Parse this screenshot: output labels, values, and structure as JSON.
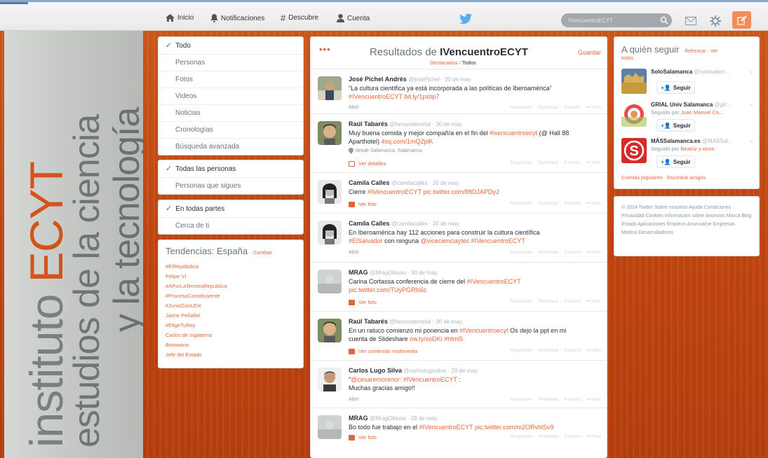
{
  "background": {
    "brand_prefix": "instituto ",
    "brand_accent": "ECYT",
    "brand_line2": "estudios de la ciencia",
    "brand_line3": "y la tecnología",
    "accent_color": "#c94a14"
  },
  "topnav": {
    "home": "Inicio",
    "notifications": "Notificaciones",
    "discover": "Descubre",
    "account": "Cuenta",
    "search_value": "IVencuentroECYT",
    "icons": [
      "home-icon",
      "bell-icon",
      "hashtag-icon",
      "person-icon",
      "twitter-bird-icon",
      "search-icon",
      "mail-icon",
      "gear-icon",
      "compose-icon"
    ]
  },
  "filters": {
    "type": [
      {
        "label": "Todo",
        "active": true
      },
      {
        "label": "Personas",
        "active": false
      },
      {
        "label": "Fotos",
        "active": false
      },
      {
        "label": "Videos",
        "active": false
      },
      {
        "label": "Noticias",
        "active": false
      },
      {
        "label": "Cronologías",
        "active": false
      },
      {
        "label": "Búsqueda avanzada",
        "active": false
      }
    ],
    "people": [
      {
        "label": "Todas las personas",
        "active": true
      },
      {
        "label": "Personas que sigues",
        "active": false
      }
    ],
    "place": [
      {
        "label": "En todas partes",
        "active": true
      },
      {
        "label": "Cerca de ti",
        "active": false
      }
    ]
  },
  "trends": {
    "title": "Tendencias: España",
    "change": "· Cambiar",
    "items": [
      "#ElReyAbdica",
      "Felipe VI",
      "#APorLaTerceraRepublica",
      "#ProcesoConstituyente",
      "#JunioConUDe",
      "Jaime Peñafiel",
      "#EligeTuRey",
      "Carlos de Inglaterra",
      "Botswana",
      "Jefe del Estado"
    ]
  },
  "results": {
    "title_prefix": "Resultados de ",
    "query": "IVencuentroECYT",
    "save": "Guardar",
    "dots": "•••",
    "subnav_top": "Destacados",
    "subnav_sep": " / ",
    "subnav_all": "Todos",
    "actions": {
      "reply": "Responder",
      "retweet": "Retwittear",
      "fav": "Favorito",
      "more": "••• Más"
    },
    "tweets": [
      {
        "name": "José Pichel Andrés",
        "handle": "@josePichel",
        "date": "30 de may.",
        "text": "“La cultura científica ya está incorporada a las políticas de Iberoamérica”",
        "text2": "#IVencuentroECYT bit.ly/1pstip7",
        "link": "Abrir"
      },
      {
        "name": "Raúl Tabarés",
        "handle": "@farsondemetal",
        "date": "30 de may.",
        "text": "Muy buena comida y mejor compañía en el fin del ",
        "hl": "#ivencuentroecyt",
        "text2": " (@ Hall 88 Aparthotel) ",
        "hl2": "4sq.com/1mQ2plK",
        "location": "desde Salamanca, Salamanca",
        "link": "Ver detalles"
      },
      {
        "name": "Camila Calles",
        "handle": "@camilacalles",
        "date": "30 de may.",
        "text": "Cierre ",
        "hl": "#IVencuentroECYT pic.twitter.com/8ftDJAPDyJ",
        "link": "Ver foto"
      },
      {
        "name": "Camila Calles",
        "handle": "@camilacalles",
        "date": "30 de may.",
        "text": "En Iberoamérica hay 112 acciones para construir la cultura científica",
        "hl": "#ElSalvador",
        "text2": " con ninguna ",
        "hl2": "@vicecienciaytec",
        "hl3": "#IVencuentroECYT",
        "link": "Abrir"
      },
      {
        "name": "MRAG",
        "handle": "@MragOktuso",
        "date": "30 de may.",
        "text": "Carina Cortassa conferencia de cierre del ",
        "hl": "#IVencuentroECYT",
        "hl2": "pic.twitter.com/TUyPGRls6c",
        "link": "Ver foto"
      },
      {
        "name": "Raúl Tabarés",
        "handle": "@farsondemetal",
        "date": "30 de may.",
        "text": "En un ratuco comienzo mi ponencia en ",
        "hl": "#IVencuentroecyt",
        "text2": " Os dejo la ppt en mi",
        "text3": "cuenta de Slideshare ",
        "hl2": "ow.ly/xoDKi #html5",
        "link": "Ver contenido multimedia"
      },
      {
        "name": "Carlos Lugo Silva",
        "handle": "@carloslugosilva",
        "date": "29 de may.",
        "text": "\"",
        "hl": "@cesaremorenor: #IVencuentroECYT",
        "text2": " :",
        "text3": "Muchas gracias amigo!!",
        "link": "Abrir"
      },
      {
        "name": "MRAG",
        "handle": "@MragOktuso",
        "date": "29 de may.",
        "text": "Bo todo fue trabajo en el ",
        "hl": "#IVencuentroECYT pic.twitter.com/m2ORvhlSv9",
        "link": "Ver foto"
      }
    ]
  },
  "who_to_follow": {
    "title": "A quién seguir",
    "refresh": "· Refrescar · Ver",
    "all": "todos",
    "follow_label": "Seguir",
    "suggestions": [
      {
        "name": "SoloSalamanca",
        "handle": "@solosalam...",
        "by": ""
      },
      {
        "name": "GRIAL Univ Salamanca",
        "handle": "@gri...",
        "by_prefix": "Seguido por ",
        "by": "Juan Manuel Co..."
      },
      {
        "name": "MÁSSalamanca.es",
        "handle": "@MASSal...",
        "by_prefix": "Seguido por ",
        "by": "Beatriz y otros"
      }
    ],
    "footer": "Cuentas populares · Encontrar amigos"
  },
  "footer": {
    "text": "© 2014 Twitter  Sobre nosotros  Ayuda  Condiciones  Privacidad  Cookies  Información sobre anuncios  Marca  Blog  Estado  Aplicaciones  Empleos  Anunciarse  Empresas  Medios  Desarrolladores"
  }
}
